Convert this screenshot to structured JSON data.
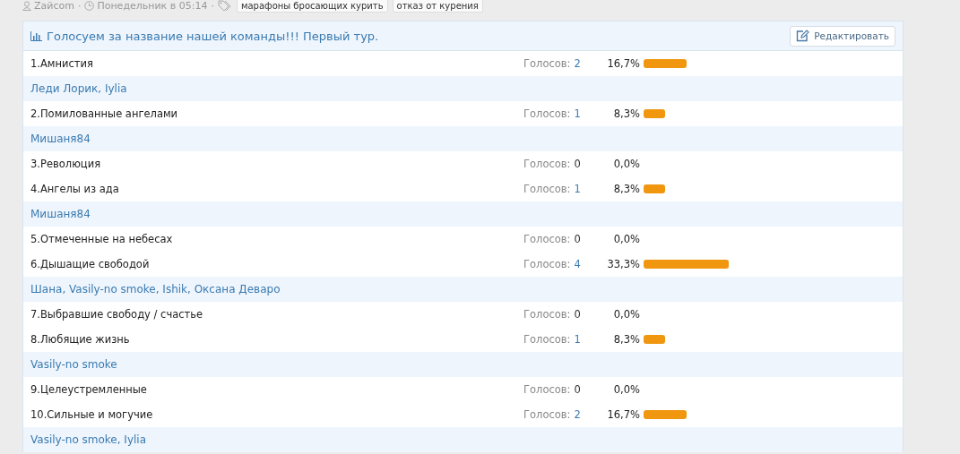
{
  "meta": {
    "author": "Zaйcom",
    "separators": [
      "·",
      "·"
    ],
    "time": "Понедельник в 05:14",
    "tags": [
      "марафоны бросающих курить",
      "отказ от курения"
    ]
  },
  "poll": {
    "title": "Голосуем за название нашей команды!!! Первый тур.",
    "edit_button": "Редактировать",
    "options": [
      {
        "label": "1.Амнистия",
        "votes_caption": "Голосов:",
        "votes": "2",
        "votes_linked": true,
        "percent": "16,7%",
        "voters": "Леди Лорик, Iylia"
      },
      {
        "label": "2.Помилованные ангелами",
        "votes_caption": "Голосов:",
        "votes": "1",
        "votes_linked": true,
        "percent": "8,3%",
        "voters": "Мишаня84"
      },
      {
        "label": "3.Революция",
        "votes_caption": "Голосов:",
        "votes": "0",
        "votes_linked": false,
        "percent": "0,0%"
      },
      {
        "label": "4.Ангелы из ада",
        "votes_caption": "Голосов:",
        "votes": "1",
        "votes_linked": true,
        "percent": "8,3%",
        "voters": "Мишаня84"
      },
      {
        "label": "5.Отмеченные на небесах",
        "votes_caption": "Голосов:",
        "votes": "0",
        "votes_linked": false,
        "percent": "0,0%"
      },
      {
        "label": "6.Дышащие свободой",
        "votes_caption": "Голосов:",
        "votes": "4",
        "votes_linked": true,
        "percent": "33,3%",
        "voters": "Шана, Vasily-no smoke, Ishik, Оксана Деваро"
      },
      {
        "label": "7.Выбравшие свободу / счастье",
        "votes_caption": "Голосов:",
        "votes": "0",
        "votes_linked": false,
        "percent": "0,0%"
      },
      {
        "label": "8.Любящие жизнь",
        "votes_caption": "Голосов:",
        "votes": "1",
        "votes_linked": true,
        "percent": "8,3%",
        "voters": "Vasily-no smoke"
      },
      {
        "label": "9.Целеустремленные",
        "votes_caption": "Голосов:",
        "votes": "0",
        "votes_linked": false,
        "percent": "0,0%"
      },
      {
        "label": "10.Сильные и могучие",
        "votes_caption": "Голосов:",
        "votes": "2",
        "votes_linked": true,
        "percent": "16,7%",
        "voters": "Vasily-no smoke, Iylia"
      }
    ]
  }
}
